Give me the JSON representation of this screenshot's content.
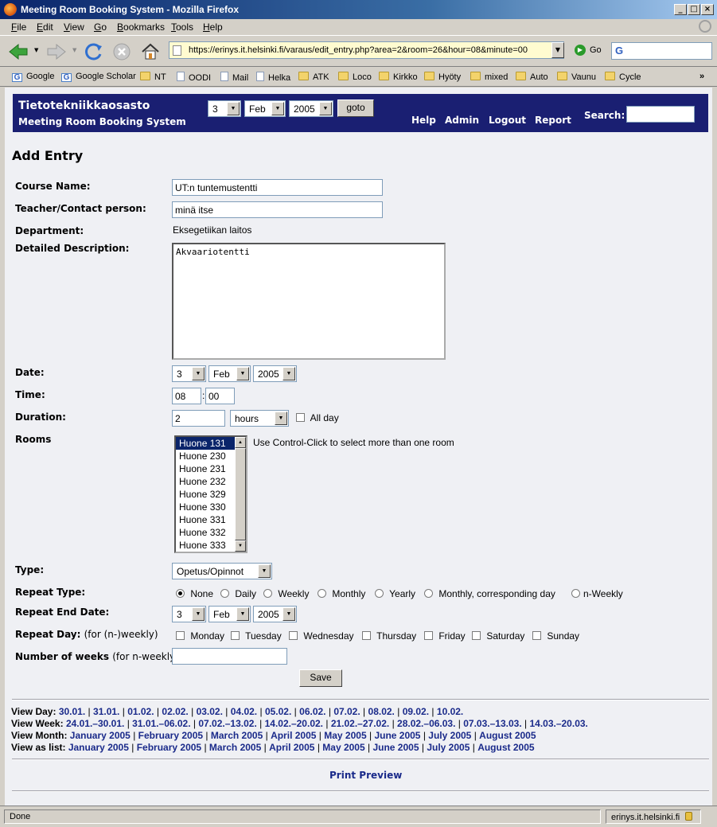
{
  "window": {
    "title": "Meeting Room Booking System - Mozilla Firefox"
  },
  "menu": [
    "File",
    "Edit",
    "View",
    "Go",
    "Bookmarks",
    "Tools",
    "Help"
  ],
  "navbar": {
    "url": "https://erinys.it.helsinki.fi/varaus/edit_entry.php?area=2&room=26&hour=08&minute=00",
    "go_label": "Go"
  },
  "bookmarks": [
    {
      "label": "Google",
      "icon": "g-icon"
    },
    {
      "label": "Google Scholar",
      "icon": "g-icon"
    },
    {
      "label": "NT",
      "icon": "folder-icon"
    },
    {
      "label": "OODI",
      "icon": "page-icon"
    },
    {
      "label": "Mail",
      "icon": "page-icon"
    },
    {
      "label": "Helka",
      "icon": "page-icon"
    },
    {
      "label": "ATK",
      "icon": "folder-icon"
    },
    {
      "label": "Loco",
      "icon": "folder-icon"
    },
    {
      "label": "Kirkko",
      "icon": "folder-icon"
    },
    {
      "label": "Hyöty",
      "icon": "folder-icon"
    },
    {
      "label": "mixed",
      "icon": "folder-icon"
    },
    {
      "label": "Auto",
      "icon": "folder-icon"
    },
    {
      "label": "Vaunu",
      "icon": "folder-icon"
    },
    {
      "label": "Cycle",
      "icon": "folder-icon"
    }
  ],
  "banner": {
    "org": "Tietotekniikkaosasto",
    "system": "Meeting Room Booking System",
    "day": "3",
    "month": "Feb",
    "year": "2005",
    "goto": "goto",
    "links": [
      "Help",
      "Admin",
      "Logout",
      "Report"
    ],
    "search_label": "Search:"
  },
  "form": {
    "heading": "Add Entry",
    "course_label": "Course Name:",
    "course_value": "UT:n tuntemustentti",
    "teacher_label": "Teacher/Contact person:",
    "teacher_value": "minä itse",
    "department_label": "Department:",
    "department_value": "Eksegetiikan laitos",
    "description_label": "Detailed Description:",
    "description_value": "Akvaariotentti",
    "date_label": "Date:",
    "date_day": "3",
    "date_month": "Feb",
    "date_year": "2005",
    "time_label": "Time:",
    "time_hour": "08",
    "time_minute": "00",
    "time_sep": ":",
    "duration_label": "Duration:",
    "duration_value": "2",
    "duration_unit": "hours",
    "allday_label": "All day",
    "rooms_label": "Rooms",
    "rooms": [
      "Huone 131",
      "Huone 230",
      "Huone 231",
      "Huone 232",
      "Huone 329",
      "Huone 330",
      "Huone 331",
      "Huone 332",
      "Huone 333"
    ],
    "rooms_selected": "Huone 131",
    "rooms_hint": "Use Control-Click to select more than one room",
    "type_label": "Type:",
    "type_value": "Opetus/Opinnot",
    "repeat_type_label": "Repeat Type:",
    "repeat_types": [
      "None",
      "Daily",
      "Weekly",
      "Monthly",
      "Yearly",
      "Monthly, corresponding day",
      "n-Weekly"
    ],
    "repeat_type_selected": "None",
    "repeat_end_label": "Repeat End Date:",
    "repeat_end_day": "3",
    "repeat_end_month": "Feb",
    "repeat_end_year": "2005",
    "repeat_day_label": "Repeat Day:",
    "repeat_day_note": "(for (n-)weekly)",
    "weekdays": [
      "Monday",
      "Tuesday",
      "Wednesday",
      "Thursday",
      "Friday",
      "Saturday",
      "Sunday"
    ],
    "num_weeks_label": "Number of weeks",
    "num_weeks_note": "(for n-weekly)",
    "save": "Save"
  },
  "views": {
    "day_label": "View Day:",
    "days": [
      "30.01.",
      "31.01.",
      "01.02.",
      "02.02.",
      "03.02.",
      "04.02.",
      "05.02.",
      "06.02.",
      "07.02.",
      "08.02.",
      "09.02.",
      "10.02."
    ],
    "week_label": "View Week:",
    "weeks": [
      "24.01.–30.01.",
      "31.01.–06.02.",
      "07.02.–13.02.",
      "14.02.–20.02.",
      "21.02.–27.02.",
      "28.02.–06.03.",
      "07.03.–13.03.",
      "14.03.–20.03."
    ],
    "month_label": "View Month:",
    "months": [
      "January 2005",
      "February 2005",
      "March 2005",
      "April 2005",
      "May 2005",
      "June 2005",
      "July 2005",
      "August 2005"
    ],
    "list_label": "View as list:",
    "lists": [
      "January 2005",
      "February 2005",
      "March 2005",
      "April 2005",
      "May 2005",
      "June 2005",
      "July 2005",
      "August 2005"
    ]
  },
  "print_preview": "Print Preview",
  "status": {
    "text": "Done",
    "host": "erinys.it.helsinki.fi"
  }
}
